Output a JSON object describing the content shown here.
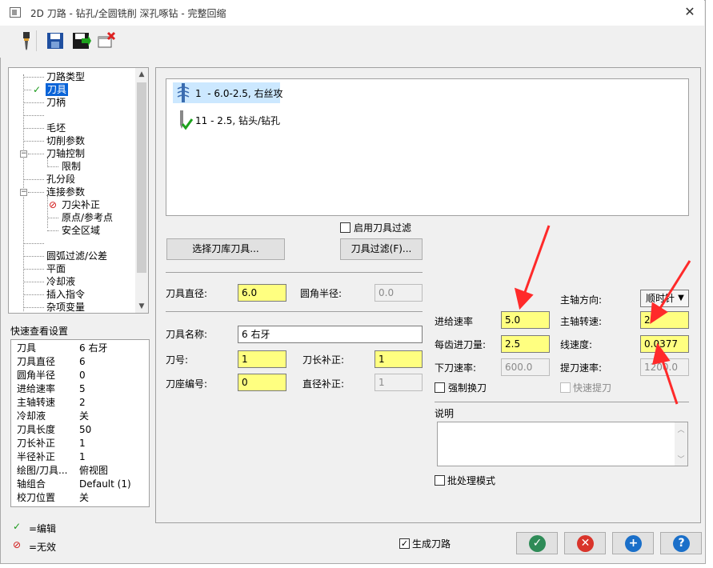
{
  "window": {
    "title": "2D 刀路 - 钻孔/全圆铣削 深孔啄钻 - 完整回缩"
  },
  "toolbar": {
    "icons": [
      "drill-tool-icon",
      "save-icon",
      "save-export-icon",
      "delete-icon"
    ]
  },
  "tree": {
    "items": [
      {
        "label": "刀路类型",
        "level": 1
      },
      {
        "label": "刀具",
        "level": 1,
        "state": "edited",
        "selected": true
      },
      {
        "label": "刀柄",
        "level": 1
      },
      {
        "label": "",
        "level": 1
      },
      {
        "label": "毛坯",
        "level": 1
      },
      {
        "label": "切削参数",
        "level": 1
      },
      {
        "label": "刀轴控制",
        "level": 1,
        "expander": "−"
      },
      {
        "label": "限制",
        "level": 2
      },
      {
        "label": "孔分段",
        "level": 1
      },
      {
        "label": "连接参数",
        "level": 1,
        "expander": "−"
      },
      {
        "label": "刀尖补正",
        "level": 2,
        "state": "disabled"
      },
      {
        "label": "原点/参考点",
        "level": 2
      },
      {
        "label": "安全区域",
        "level": 2
      },
      {
        "label": "",
        "level": 1
      },
      {
        "label": "圆弧过滤/公差",
        "level": 1
      },
      {
        "label": "平面",
        "level": 1
      },
      {
        "label": "冷却液",
        "level": 1
      },
      {
        "label": "插入指令",
        "level": 1
      },
      {
        "label": "杂项变量",
        "level": 1
      }
    ]
  },
  "quick_view": {
    "title": "快速查看设置",
    "rows": [
      {
        "k": "刀具",
        "v": "6 右牙"
      },
      {
        "k": "刀具直径",
        "v": "6"
      },
      {
        "k": "圆角半径",
        "v": "0"
      },
      {
        "k": "进给速率",
        "v": "5"
      },
      {
        "k": "主轴转速",
        "v": "2"
      },
      {
        "k": "冷却液",
        "v": "关"
      },
      {
        "k": "刀具长度",
        "v": "50"
      },
      {
        "k": "刀长补正",
        "v": "1"
      },
      {
        "k": "半径补正",
        "v": "1"
      },
      {
        "k": "绘图/刀具...",
        "v": "俯视图"
      },
      {
        "k": "轴组合",
        "v": "Default (1)"
      },
      {
        "k": "校刀位置",
        "v": "关"
      }
    ]
  },
  "legend": {
    "edited": "=编辑",
    "disabled": "=无效"
  },
  "tool_list": [
    {
      "num": "1",
      "desc": "- 6.0-2.5, 右丝攻"
    },
    {
      "num": "11",
      "desc": "- 2.5, 钻头/钻孔"
    }
  ],
  "buttons": {
    "select_library": "选择刀库刀具...",
    "tool_filter": "刀具过滤(F)...",
    "enable_filter": "启用刀具过滤"
  },
  "params": {
    "tool_diameter": {
      "label": "刀具直径:",
      "value": "6.0"
    },
    "corner_radius": {
      "label": "圆角半径:",
      "value": "0.0"
    },
    "tool_name": {
      "label": "刀具名称:",
      "value": "6 右牙"
    },
    "tool_number": {
      "label": "刀号:",
      "value": "1"
    },
    "length_offset": {
      "label": "刀长补正:",
      "value": "1"
    },
    "holder_number": {
      "label": "刀座编号:",
      "value": "0"
    },
    "diameter_offset": {
      "label": "直径补正:",
      "value": "1"
    },
    "feed_rate": {
      "label": "进给速率",
      "value": "5.0"
    },
    "feed_per_tooth": {
      "label": "每齿进刀量:",
      "value": "2.5"
    },
    "plunge_rate": {
      "label": "下刀速率:",
      "value": "600.0"
    },
    "spindle_dir": {
      "label": "主轴方向:",
      "value": "顺时针"
    },
    "spindle_speed": {
      "label": "主轴转速:",
      "value": "2"
    },
    "surface_speed": {
      "label": "线速度:",
      "value": "0.0377"
    },
    "retract_rate": {
      "label": "提刀速率:",
      "value": "1200.0"
    },
    "force_tool_change": "强制换刀",
    "rapid_retract": "快速提刀",
    "comment_label": "说明",
    "batch_mode": "批处理模式",
    "generate_toolpath": "生成刀路"
  },
  "colors": {
    "highlight_field": "#ffff80",
    "ok": "#2e8b57",
    "cancel": "#d9342b",
    "add": "#1a6fc9",
    "help": "#1a6fc9",
    "annotation_arrow": "#ff2a2a"
  }
}
